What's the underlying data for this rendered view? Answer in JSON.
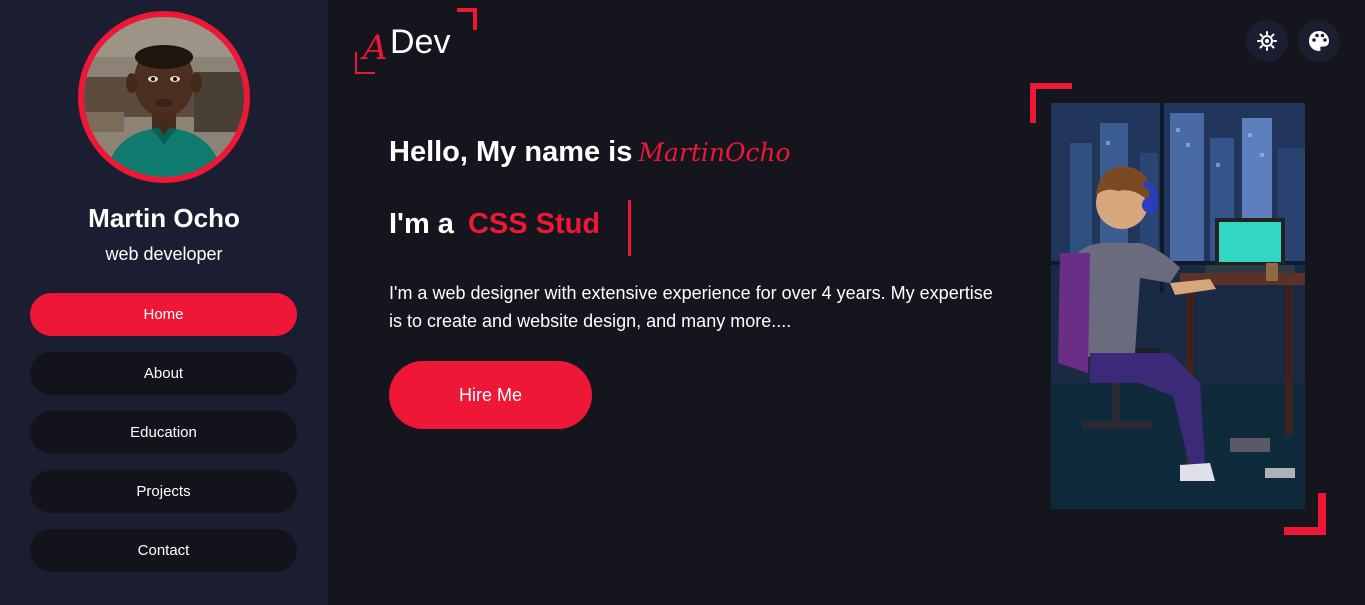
{
  "profile": {
    "name": "Martin Ocho",
    "role": "web developer"
  },
  "nav": {
    "items": [
      {
        "label": "Home",
        "active": true
      },
      {
        "label": "About",
        "active": false
      },
      {
        "label": "Education",
        "active": false
      },
      {
        "label": "Projects",
        "active": false
      },
      {
        "label": "Contact",
        "active": false
      }
    ]
  },
  "header": {
    "logo_accent": "A",
    "logo_text": "Dev",
    "theme_toggle_icon": "sun-icon",
    "palette_icon": "palette-icon"
  },
  "hero": {
    "greeting": "Hello, My name is",
    "signature": "MartinOcho",
    "im_a": "I'm a",
    "typed_text": "CSS Stud",
    "description": "I'm a web designer with extensive experience for over 4 years. My expertise is to create and website design, and many more....",
    "button_label": "Hire Me"
  },
  "colors": {
    "accent": "#ee1836",
    "background": "#15151d",
    "sidebar": "#1b1e30"
  }
}
